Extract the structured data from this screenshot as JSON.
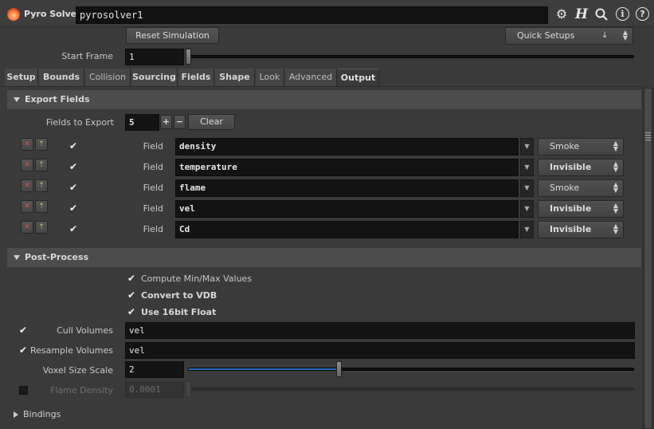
{
  "header": {
    "node_type": "Pyro Solver",
    "node_name": "pyrosolver1",
    "icons": [
      "gear-icon",
      "help-h-icon",
      "search-icon",
      "info-icon",
      "help-icon"
    ]
  },
  "top": {
    "reset_label": "Reset Simulation",
    "quick_setups_label": "Quick Setups",
    "start_frame_label": "Start Frame",
    "start_frame_value": "1"
  },
  "tabs": [
    "Setup",
    "Bounds",
    "Collision",
    "Sourcing",
    "Fields",
    "Shape",
    "Look",
    "Advanced",
    "Output"
  ],
  "active_tab": "Output",
  "export_fields": {
    "title": "Export Fields",
    "count_label": "Fields to Export",
    "count_value": "5",
    "plus": "+",
    "minus": "−",
    "clear_label": "Clear",
    "field_label": "Field",
    "rows": [
      {
        "name": "density",
        "mode": "Smoke"
      },
      {
        "name": "temperature",
        "mode": "Invisible"
      },
      {
        "name": "flame",
        "mode": "Smoke"
      },
      {
        "name": "vel",
        "mode": "Invisible"
      },
      {
        "name": "Cd",
        "mode": "Invisible"
      }
    ]
  },
  "post_process": {
    "title": "Post-Process",
    "compute_minmax": "Compute Min/Max Values",
    "convert_vdb": "Convert to VDB",
    "use_16bit": "Use 16bit Float",
    "cull_label": "Cull Volumes",
    "cull_value": "vel",
    "resample_label": "Resample Volumes",
    "resample_value": "vel",
    "voxel_label": "Voxel Size Scale",
    "voxel_value": "2",
    "voxel_level": 0.34,
    "flame_density_label": "Flame Density",
    "flame_density_value": "0.0001"
  },
  "bindings": {
    "title": "Bindings"
  },
  "colors": {
    "accent_blue": "#2c6fbf",
    "background": "#3a3a3a"
  }
}
